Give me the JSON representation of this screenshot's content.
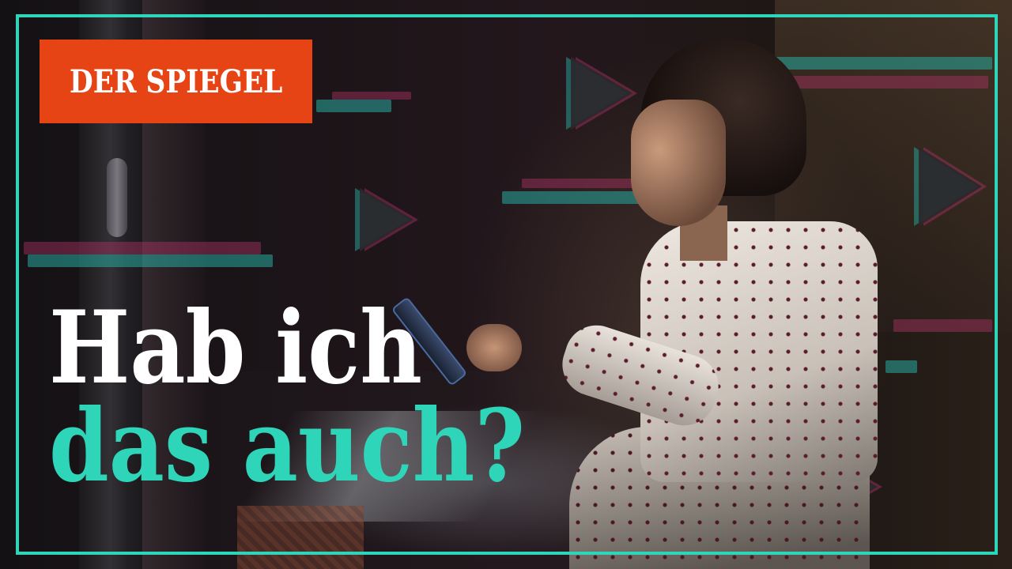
{
  "logo": {
    "text": "DER SPIEGEL",
    "background_color": "#e64415",
    "text_color": "#ffffff"
  },
  "headline": {
    "line1": "Hab ich",
    "line2": "das auch?",
    "line1_color": "#ffffff",
    "line2_color": "#2fd5b8"
  },
  "frame": {
    "border_color": "#2fd5b8"
  },
  "photo": {
    "subject": "girl in heart-pattern pajamas looking at phone on bed in dark room",
    "decorations": "neon play-button icons and horizontal bars in teal and magenta"
  }
}
